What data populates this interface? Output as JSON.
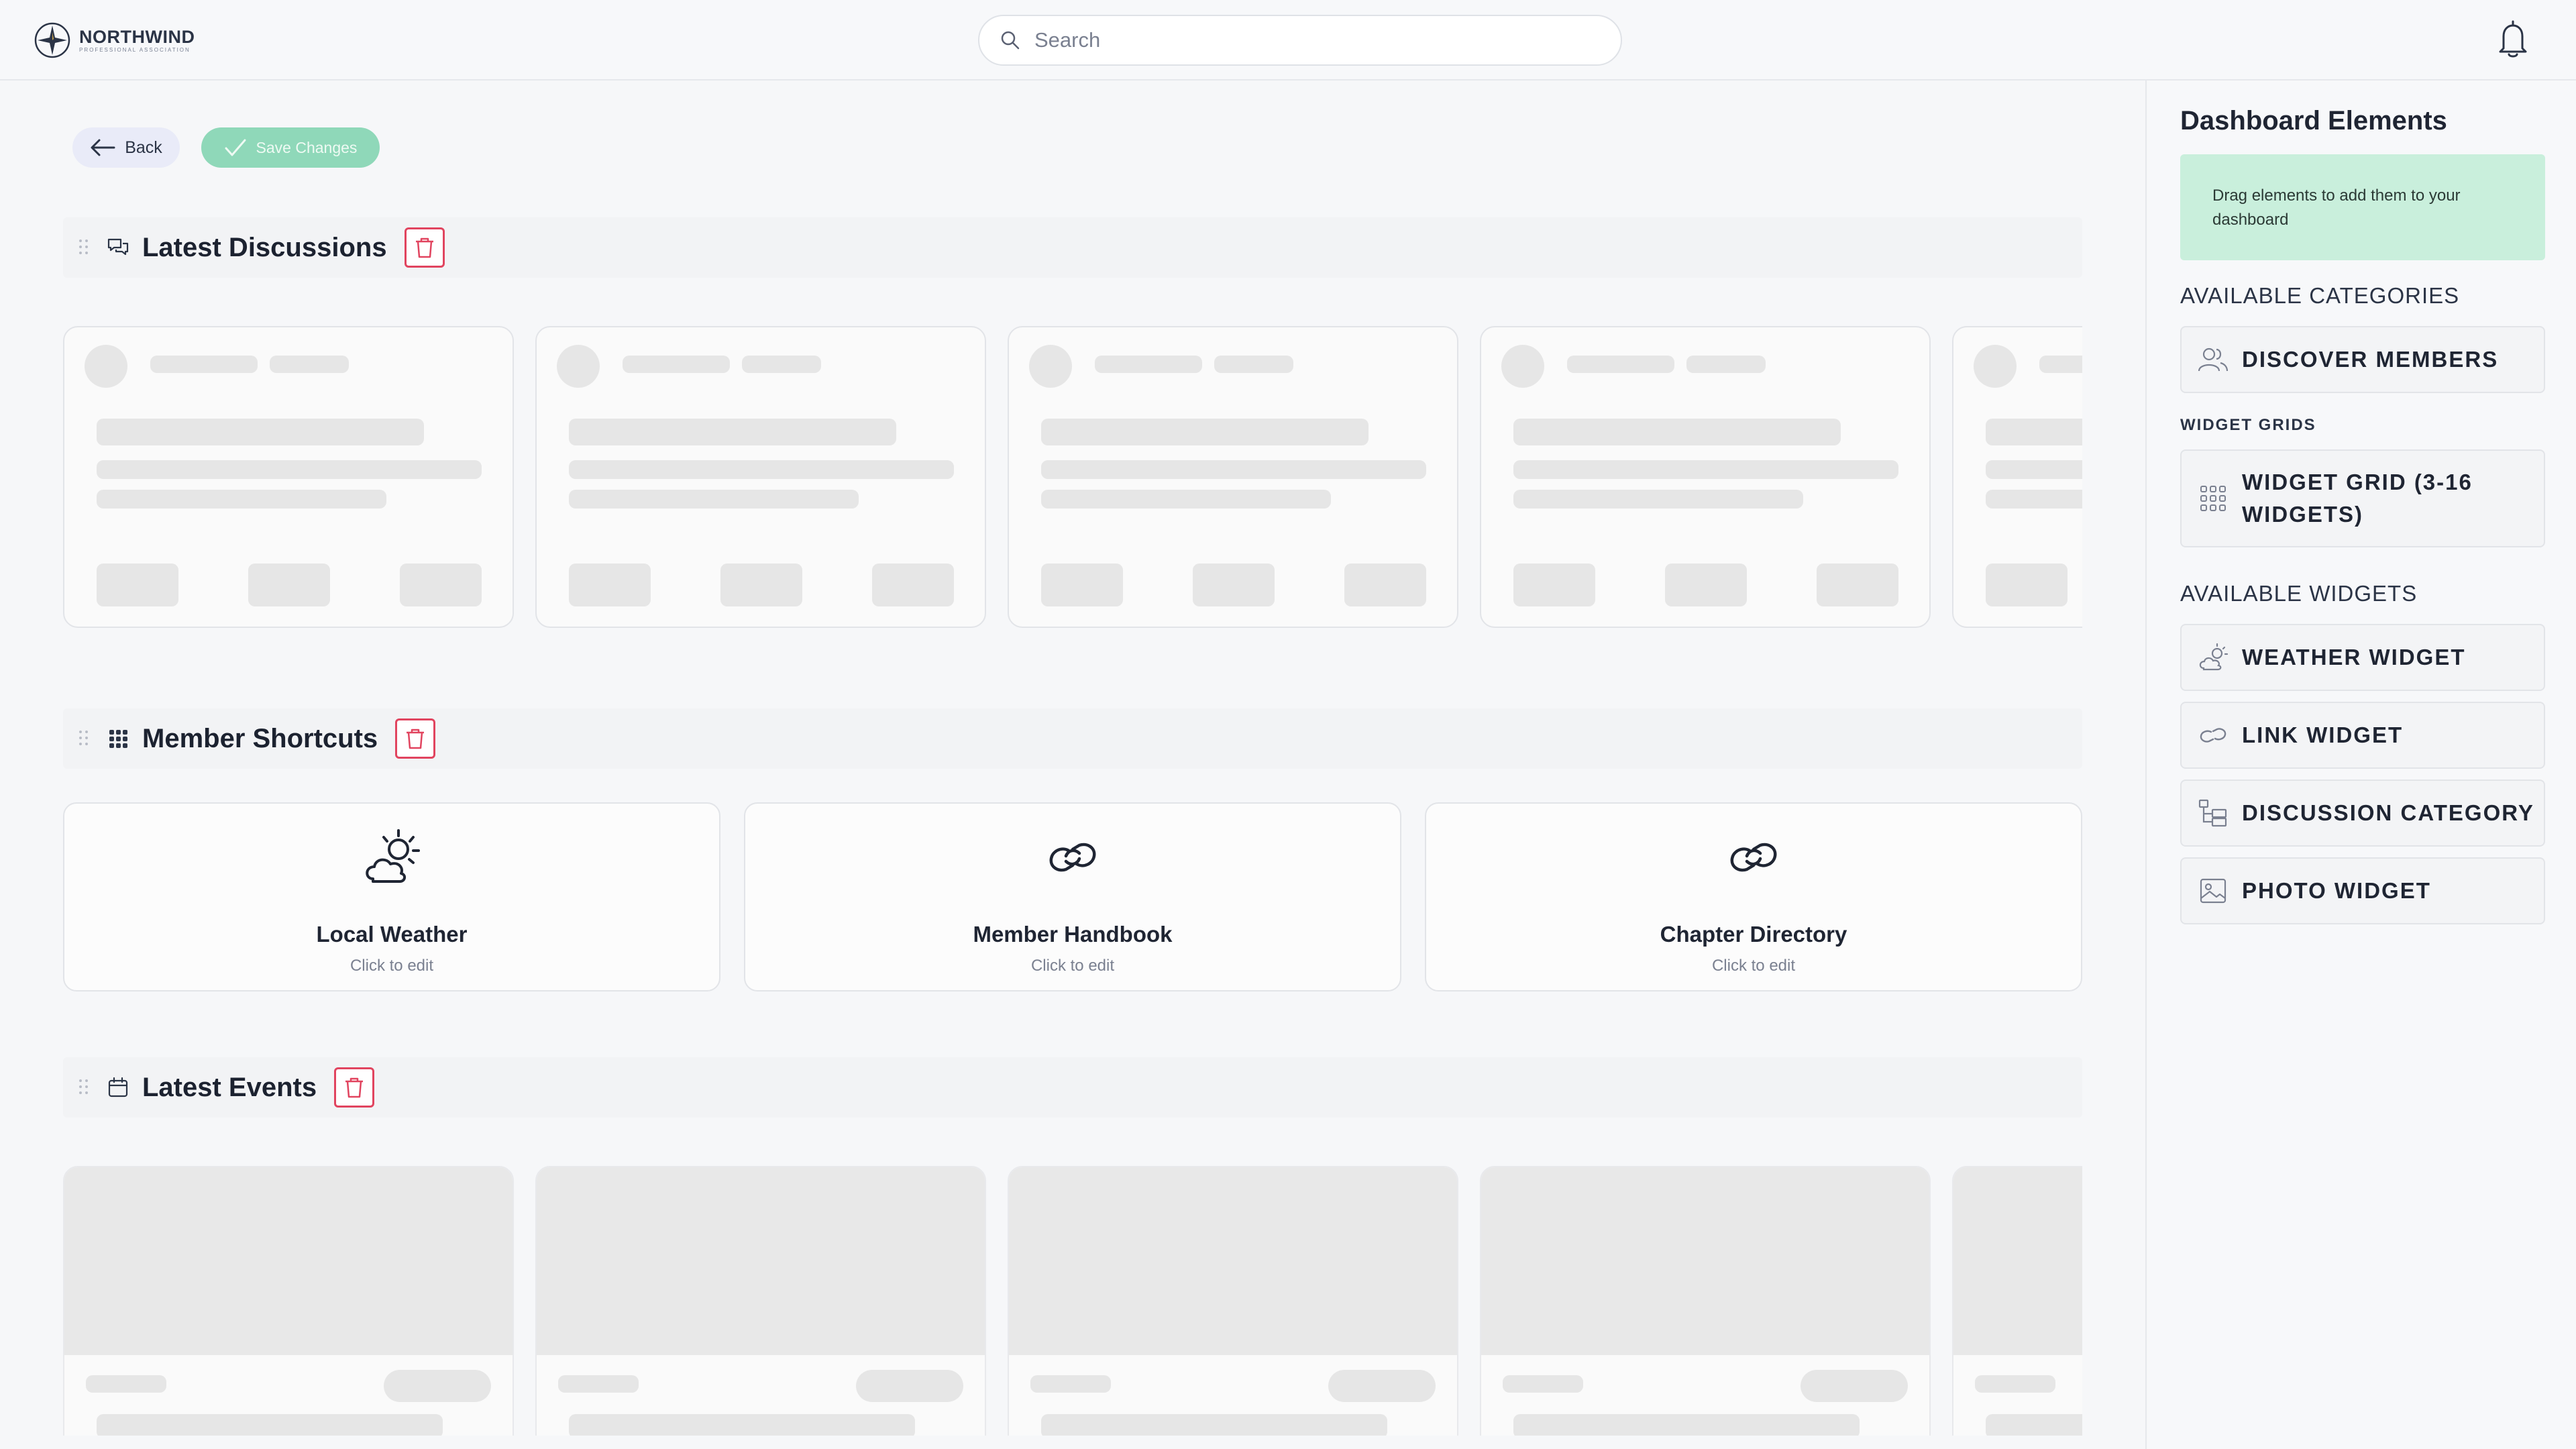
{
  "brand": {
    "name": "NORTHWIND",
    "tagline": "PROFESSIONAL ASSOCIATION",
    "colors": {
      "navy": "#2b3446",
      "accent_green": "#8fd8b9",
      "danger": "#e1445f",
      "hint_bg": "#c9efdc"
    }
  },
  "header": {
    "search_placeholder": "Search",
    "search_icon": "search-icon",
    "notification_icon": "bell-icon"
  },
  "toolbar": {
    "back_label": "Back",
    "save_label": "Save Changes"
  },
  "sections": {
    "discussions": {
      "title": "Latest Discussions",
      "icon": "chat-bubbles-icon"
    },
    "shortcuts": {
      "title": "Member Shortcuts",
      "icon": "grid-icon",
      "cards": [
        {
          "title": "Local Weather",
          "subtitle": "Click to edit",
          "icon": "weather-icon"
        },
        {
          "title": "Member Handbook",
          "subtitle": "Click to edit",
          "icon": "link-icon"
        },
        {
          "title": "Chapter Directory",
          "subtitle": "Click to edit",
          "icon": "link-icon"
        }
      ]
    },
    "events": {
      "title": "Latest Events",
      "icon": "calendar-icon"
    }
  },
  "sidebar": {
    "title": "Dashboard Elements",
    "hint": "Drag elements to add them to your dashboard",
    "categories_label": "AVAILABLE CATEGORIES",
    "categories": [
      {
        "label": "DISCOVER MEMBERS",
        "icon": "users-icon"
      }
    ],
    "grids_label": "WIDGET GRIDS",
    "grids": [
      {
        "label": "WIDGET GRID (3-16 WIDGETS)",
        "icon": "grid-icon"
      }
    ],
    "widgets_label": "AVAILABLE WIDGETS",
    "widgets": [
      {
        "label": "WEATHER WIDGET",
        "icon": "weather-icon"
      },
      {
        "label": "LINK WIDGET",
        "icon": "link-icon"
      },
      {
        "label": "DISCUSSION CATEGORY",
        "icon": "category-icon"
      },
      {
        "label": "PHOTO WIDGET",
        "icon": "photo-icon"
      }
    ]
  }
}
